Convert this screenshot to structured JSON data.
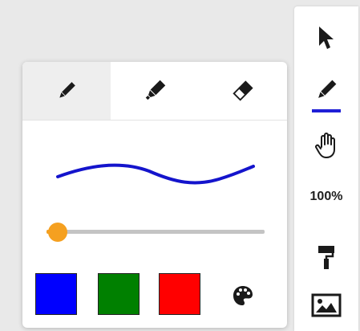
{
  "toolbar": {
    "tools": [
      {
        "name": "select",
        "icon": "cursor-arrow-icon"
      },
      {
        "name": "pen",
        "icon": "pencil-icon",
        "active": true,
        "underline_color": "#1f1fd6"
      },
      {
        "name": "pan",
        "icon": "hand-icon"
      },
      {
        "name": "zoom",
        "icon": "zoom-label"
      },
      {
        "name": "paint",
        "icon": "paint-roller-icon"
      },
      {
        "name": "image",
        "icon": "image-icon"
      }
    ],
    "zoom_label": "100%"
  },
  "draw_panel": {
    "tabs": [
      {
        "name": "pen",
        "icon": "pencil-icon",
        "active": true
      },
      {
        "name": "highlighter",
        "icon": "marker-icon",
        "active": false
      },
      {
        "name": "eraser",
        "icon": "eraser-icon",
        "active": false
      }
    ],
    "stroke_preview_color": "#1414cc",
    "stroke_width": {
      "value_fraction": 0.05,
      "color": "#f5a020"
    },
    "colors": [
      {
        "name": "blue",
        "hex": "#0000ff"
      },
      {
        "name": "green",
        "hex": "#008000"
      },
      {
        "name": "red",
        "hex": "#ff0000"
      }
    ],
    "palette_icon": "palette-icon"
  }
}
